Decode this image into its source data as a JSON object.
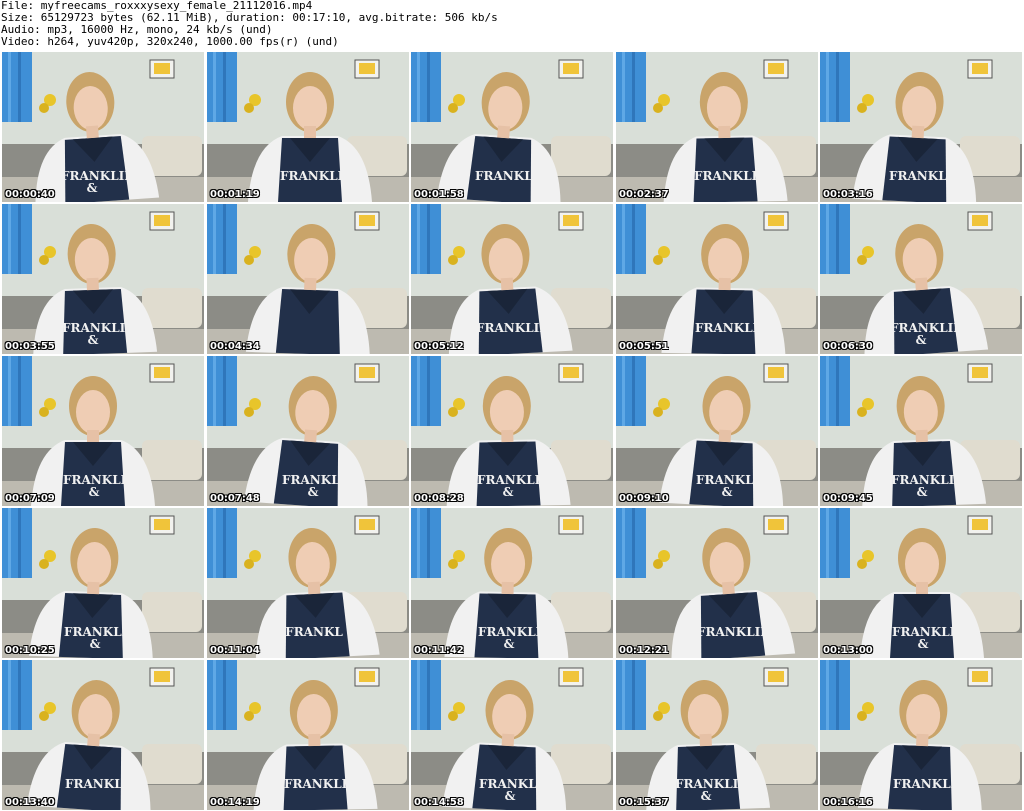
{
  "header": {
    "file_line": "File: myfreecams_roxxxysexy_female_21112016.mp4",
    "size_line": "Size: 65129723 bytes (62.11 MiB), duration: 00:17:10, avg.bitrate: 506 kb/s",
    "audio_line": "Audio: mp3, 16000 Hz, mono, 24 kb/s (und)",
    "video_line": "Video: h264, yuv420p, 320x240, 1000.00 fps(r) (und)"
  },
  "thumbnails": [
    {
      "time": "00:00:40",
      "text": "FRANKLIN &"
    },
    {
      "time": "00:01:19",
      "text": "FRANKLIN"
    },
    {
      "time": "00:01:58",
      "text": "FRANKLIN"
    },
    {
      "time": "00:02:37",
      "text": "FRANKLIN"
    },
    {
      "time": "00:03:16",
      "text": "FRANKLIN"
    },
    {
      "time": "00:03:55",
      "text": "FRANKLIN &"
    },
    {
      "time": "00:04:34",
      "text": ""
    },
    {
      "time": "00:05:12",
      "text": "FRANKLIN"
    },
    {
      "time": "00:05:51",
      "text": "FRANKLIN"
    },
    {
      "time": "00:06:30",
      "text": "FRANKLIN &"
    },
    {
      "time": "00:07:09",
      "text": "FRANKLIN &"
    },
    {
      "time": "00:07:48",
      "text": "FRANKLIN &"
    },
    {
      "time": "00:08:28",
      "text": "FRANKLIN &"
    },
    {
      "time": "00:09:10",
      "text": "FRANKLIN &"
    },
    {
      "time": "00:09:45",
      "text": "FRANKLIN &"
    },
    {
      "time": "00:10:25",
      "text": "FRANKLIN &"
    },
    {
      "time": "00:11:04",
      "text": "FRANKL"
    },
    {
      "time": "00:11:42",
      "text": "FRANKLIN &"
    },
    {
      "time": "00:12:21",
      "text": "FRANKLIN"
    },
    {
      "time": "00:13:00",
      "text": "FRANKLIN &"
    },
    {
      "time": "00:13:40",
      "text": "FRANKLI"
    },
    {
      "time": "00:14:19",
      "text": "FRANKLIN"
    },
    {
      "time": "00:14:58",
      "text": "FRANKLIN &"
    },
    {
      "time": "00:15:37",
      "text": "FRANKLIN &"
    },
    {
      "time": "00:16:16",
      "text": "FRANKLIN"
    }
  ]
}
